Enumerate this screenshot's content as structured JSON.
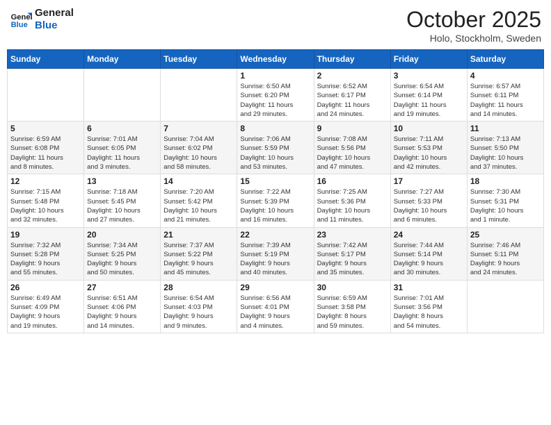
{
  "header": {
    "logo_line1": "General",
    "logo_line2": "Blue",
    "month": "October 2025",
    "location": "Holo, Stockholm, Sweden"
  },
  "weekdays": [
    "Sunday",
    "Monday",
    "Tuesday",
    "Wednesday",
    "Thursday",
    "Friday",
    "Saturday"
  ],
  "weeks": [
    [
      {
        "day": "",
        "info": ""
      },
      {
        "day": "",
        "info": ""
      },
      {
        "day": "",
        "info": ""
      },
      {
        "day": "1",
        "info": "Sunrise: 6:50 AM\nSunset: 6:20 PM\nDaylight: 11 hours\nand 29 minutes."
      },
      {
        "day": "2",
        "info": "Sunrise: 6:52 AM\nSunset: 6:17 PM\nDaylight: 11 hours\nand 24 minutes."
      },
      {
        "day": "3",
        "info": "Sunrise: 6:54 AM\nSunset: 6:14 PM\nDaylight: 11 hours\nand 19 minutes."
      },
      {
        "day": "4",
        "info": "Sunrise: 6:57 AM\nSunset: 6:11 PM\nDaylight: 11 hours\nand 14 minutes."
      }
    ],
    [
      {
        "day": "5",
        "info": "Sunrise: 6:59 AM\nSunset: 6:08 PM\nDaylight: 11 hours\nand 8 minutes."
      },
      {
        "day": "6",
        "info": "Sunrise: 7:01 AM\nSunset: 6:05 PM\nDaylight: 11 hours\nand 3 minutes."
      },
      {
        "day": "7",
        "info": "Sunrise: 7:04 AM\nSunset: 6:02 PM\nDaylight: 10 hours\nand 58 minutes."
      },
      {
        "day": "8",
        "info": "Sunrise: 7:06 AM\nSunset: 5:59 PM\nDaylight: 10 hours\nand 53 minutes."
      },
      {
        "day": "9",
        "info": "Sunrise: 7:08 AM\nSunset: 5:56 PM\nDaylight: 10 hours\nand 47 minutes."
      },
      {
        "day": "10",
        "info": "Sunrise: 7:11 AM\nSunset: 5:53 PM\nDaylight: 10 hours\nand 42 minutes."
      },
      {
        "day": "11",
        "info": "Sunrise: 7:13 AM\nSunset: 5:50 PM\nDaylight: 10 hours\nand 37 minutes."
      }
    ],
    [
      {
        "day": "12",
        "info": "Sunrise: 7:15 AM\nSunset: 5:48 PM\nDaylight: 10 hours\nand 32 minutes."
      },
      {
        "day": "13",
        "info": "Sunrise: 7:18 AM\nSunset: 5:45 PM\nDaylight: 10 hours\nand 27 minutes."
      },
      {
        "day": "14",
        "info": "Sunrise: 7:20 AM\nSunset: 5:42 PM\nDaylight: 10 hours\nand 21 minutes."
      },
      {
        "day": "15",
        "info": "Sunrise: 7:22 AM\nSunset: 5:39 PM\nDaylight: 10 hours\nand 16 minutes."
      },
      {
        "day": "16",
        "info": "Sunrise: 7:25 AM\nSunset: 5:36 PM\nDaylight: 10 hours\nand 11 minutes."
      },
      {
        "day": "17",
        "info": "Sunrise: 7:27 AM\nSunset: 5:33 PM\nDaylight: 10 hours\nand 6 minutes."
      },
      {
        "day": "18",
        "info": "Sunrise: 7:30 AM\nSunset: 5:31 PM\nDaylight: 10 hours\nand 1 minute."
      }
    ],
    [
      {
        "day": "19",
        "info": "Sunrise: 7:32 AM\nSunset: 5:28 PM\nDaylight: 9 hours\nand 55 minutes."
      },
      {
        "day": "20",
        "info": "Sunrise: 7:34 AM\nSunset: 5:25 PM\nDaylight: 9 hours\nand 50 minutes."
      },
      {
        "day": "21",
        "info": "Sunrise: 7:37 AM\nSunset: 5:22 PM\nDaylight: 9 hours\nand 45 minutes."
      },
      {
        "day": "22",
        "info": "Sunrise: 7:39 AM\nSunset: 5:19 PM\nDaylight: 9 hours\nand 40 minutes."
      },
      {
        "day": "23",
        "info": "Sunrise: 7:42 AM\nSunset: 5:17 PM\nDaylight: 9 hours\nand 35 minutes."
      },
      {
        "day": "24",
        "info": "Sunrise: 7:44 AM\nSunset: 5:14 PM\nDaylight: 9 hours\nand 30 minutes."
      },
      {
        "day": "25",
        "info": "Sunrise: 7:46 AM\nSunset: 5:11 PM\nDaylight: 9 hours\nand 24 minutes."
      }
    ],
    [
      {
        "day": "26",
        "info": "Sunrise: 6:49 AM\nSunset: 4:09 PM\nDaylight: 9 hours\nand 19 minutes."
      },
      {
        "day": "27",
        "info": "Sunrise: 6:51 AM\nSunset: 4:06 PM\nDaylight: 9 hours\nand 14 minutes."
      },
      {
        "day": "28",
        "info": "Sunrise: 6:54 AM\nSunset: 4:03 PM\nDaylight: 9 hours\nand 9 minutes."
      },
      {
        "day": "29",
        "info": "Sunrise: 6:56 AM\nSunset: 4:01 PM\nDaylight: 9 hours\nand 4 minutes."
      },
      {
        "day": "30",
        "info": "Sunrise: 6:59 AM\nSunset: 3:58 PM\nDaylight: 8 hours\nand 59 minutes."
      },
      {
        "day": "31",
        "info": "Sunrise: 7:01 AM\nSunset: 3:56 PM\nDaylight: 8 hours\nand 54 minutes."
      },
      {
        "day": "",
        "info": ""
      }
    ]
  ]
}
